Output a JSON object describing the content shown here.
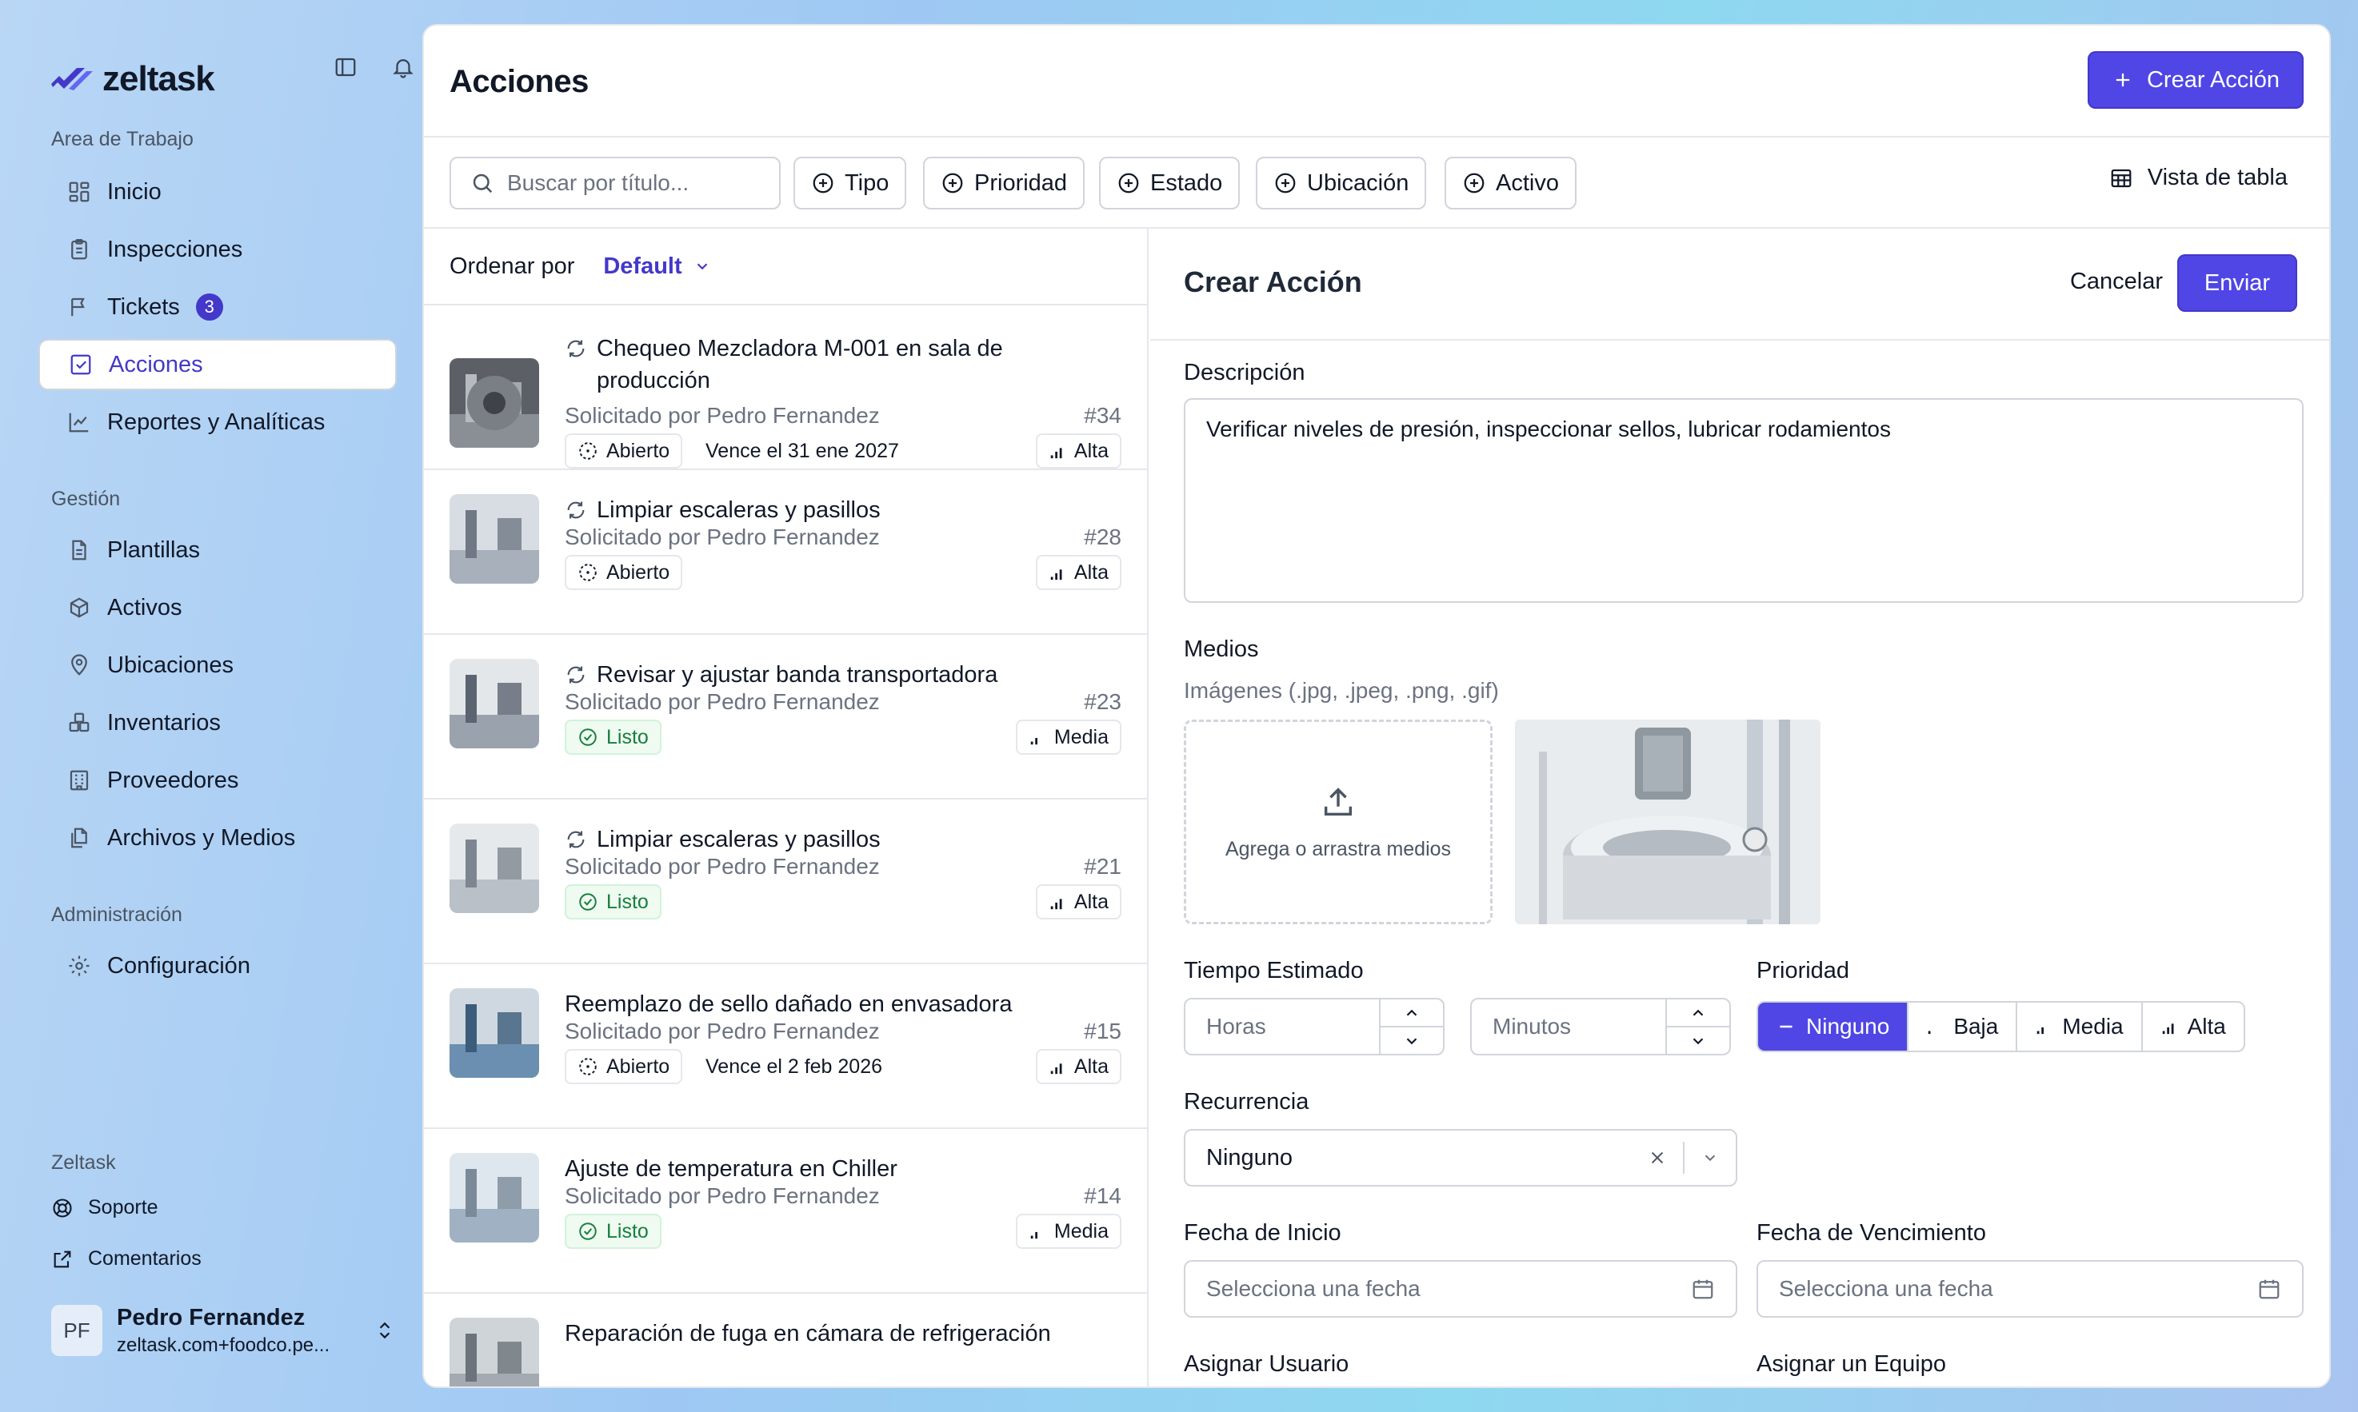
{
  "app": {
    "name": "zeltask"
  },
  "sidebar": {
    "workspace_title": "Area de Trabajo",
    "workspace_items": [
      {
        "label": "Inicio",
        "icon": "grid-icon"
      },
      {
        "label": "Inspecciones",
        "icon": "clipboard-icon"
      },
      {
        "label": "Tickets",
        "icon": "flag-icon",
        "badge": "3"
      },
      {
        "label": "Acciones",
        "icon": "check-square-icon",
        "active": true
      },
      {
        "label": "Reportes y Analíticas",
        "icon": "chart-line-icon"
      }
    ],
    "management_title": "Gestión",
    "management_items": [
      {
        "label": "Plantillas",
        "icon": "file-text-icon"
      },
      {
        "label": "Activos",
        "icon": "box-icon"
      },
      {
        "label": "Ubicaciones",
        "icon": "map-pin-icon"
      },
      {
        "label": "Inventarios",
        "icon": "boxes-icon"
      },
      {
        "label": "Proveedores",
        "icon": "building-icon"
      },
      {
        "label": "Archivos y Medios",
        "icon": "files-icon"
      }
    ],
    "admin_title": "Administración",
    "admin_items": [
      {
        "label": "Configuración",
        "icon": "gear-icon"
      }
    ],
    "footer_title": "Zeltask",
    "footer_items": [
      {
        "label": "Soporte",
        "icon": "lifebuoy-icon"
      },
      {
        "label": "Comentarios",
        "icon": "external-link-icon"
      }
    ],
    "user": {
      "initials": "PF",
      "name": "Pedro Fernandez",
      "email": "zeltask.com+foodco.pe..."
    }
  },
  "header": {
    "title": "Acciones",
    "create_label": "Crear Acción"
  },
  "filters": {
    "search_placeholder": "Buscar por título...",
    "chips": [
      "Tipo",
      "Prioridad",
      "Estado",
      "Ubicación",
      "Activo"
    ],
    "view_label": "Vista de tabla"
  },
  "list": {
    "sort_label": "Ordenar por",
    "sort_value": "Default",
    "items": [
      {
        "title": "Chequeo Mezcladora M-001 en sala de producción",
        "recurring": true,
        "requested": "Solicitado por Pedro Fernandez",
        "number": "#34",
        "status": "Abierto",
        "due": "Vence el 31 ene 2027",
        "priority": "Alta"
      },
      {
        "title": "Limpiar escaleras y pasillos",
        "recurring": true,
        "requested": "Solicitado por Pedro Fernandez",
        "number": "#28",
        "status": "Abierto",
        "due": "",
        "priority": "Alta"
      },
      {
        "title": "Revisar y ajustar banda transportadora",
        "recurring": true,
        "requested": "Solicitado por Pedro Fernandez",
        "number": "#23",
        "status": "Listo",
        "due": "",
        "priority": "Media"
      },
      {
        "title": "Limpiar escaleras y pasillos",
        "recurring": true,
        "requested": "Solicitado por Pedro Fernandez",
        "number": "#21",
        "status": "Listo",
        "due": "",
        "priority": "Alta"
      },
      {
        "title": "Reemplazo de sello dañado en envasadora",
        "recurring": false,
        "requested": "Solicitado por Pedro Fernandez",
        "number": "#15",
        "status": "Abierto",
        "due": "Vence el 2 feb 2026",
        "priority": "Alta"
      },
      {
        "title": "Ajuste de temperatura en Chiller",
        "recurring": false,
        "requested": "Solicitado por Pedro Fernandez",
        "number": "#14",
        "status": "Listo",
        "due": "",
        "priority": "Media"
      },
      {
        "title": "Reparación de fuga en cámara de refrigeración",
        "recurring": false,
        "requested": "",
        "number": "",
        "status": "",
        "due": "",
        "priority": ""
      }
    ]
  },
  "form": {
    "title": "Crear Acción",
    "cancel_label": "Cancelar",
    "submit_label": "Enviar",
    "description_label": "Descripción",
    "description_value": "Verificar niveles de presión, inspeccionar sellos, lubricar rodamientos",
    "media_label": "Medios",
    "media_hint": "Imágenes (.jpg, .jpeg, .png, .gif)",
    "dropzone_label": "Agrega o arrastra medios",
    "time_label": "Tiempo Estimado",
    "hours_placeholder": "Horas",
    "minutes_placeholder": "Minutos",
    "priority_label": "Prioridad",
    "priority_options": [
      "Ninguno",
      "Baja",
      "Media",
      "Alta"
    ],
    "priority_selected": "Ninguno",
    "recurrence_label": "Recurrencia",
    "recurrence_value": "Ninguno",
    "start_label": "Fecha de Inicio",
    "start_placeholder": "Selecciona una fecha",
    "due_label": "Fecha de Vencimiento",
    "due_placeholder": "Selecciona una fecha",
    "assign_user_label": "Asignar Usuario",
    "assign_team_label": "Asignar un Equipo"
  },
  "colors": {
    "accent": "#4f46e5",
    "done": "#15803d",
    "border": "#e5e7eb"
  }
}
